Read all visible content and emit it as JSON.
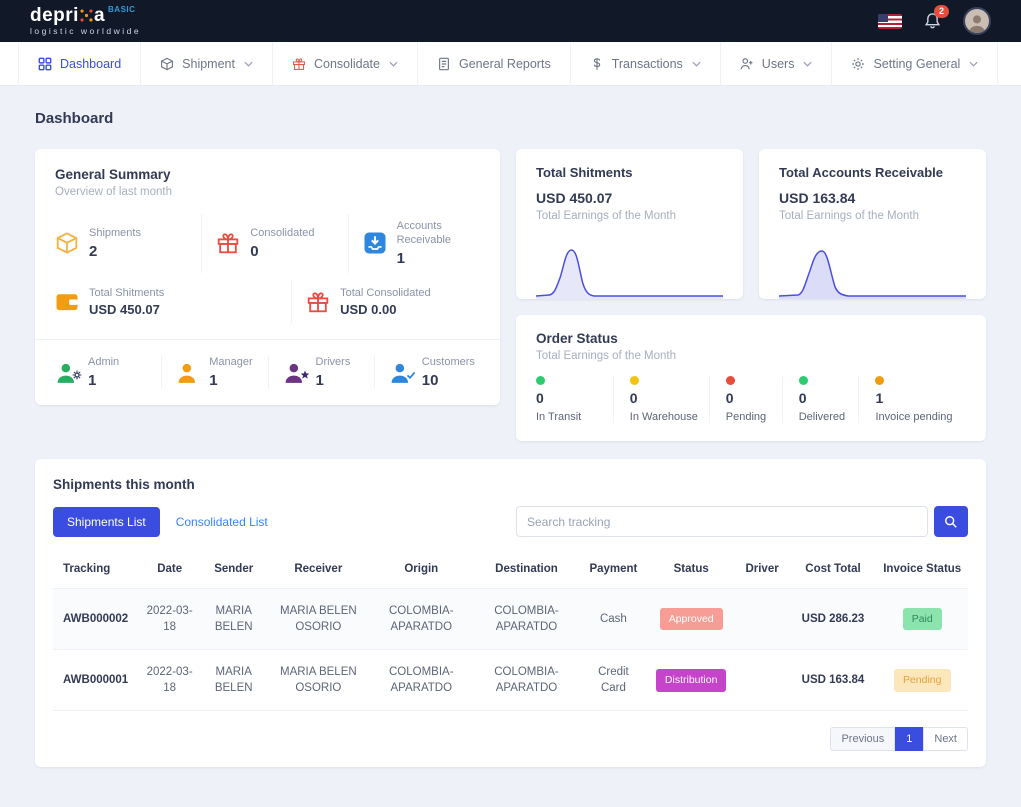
{
  "colors": {
    "primary": "#3b4de0",
    "dark_nav": "#111827",
    "badge_red": "#e74c3c"
  },
  "topbar": {
    "logo_pre": "depri",
    "logo_post": "a",
    "logo_badge": "BASIC",
    "tagline": "logistic  worldwide",
    "notification_count": "2"
  },
  "menu": {
    "items": [
      {
        "label": "Dashboard",
        "icon": "dashboard-icon",
        "active": true,
        "dropdown": false
      },
      {
        "label": "Shipment",
        "icon": "box-icon",
        "active": false,
        "dropdown": true
      },
      {
        "label": "Consolidate",
        "icon": "gift-icon",
        "active": false,
        "dropdown": true
      },
      {
        "label": "General Reports",
        "icon": "report-icon",
        "active": false,
        "dropdown": false
      },
      {
        "label": "Transactions",
        "icon": "dollar-icon",
        "active": false,
        "dropdown": true
      },
      {
        "label": "Users",
        "icon": "user-plus-icon",
        "active": false,
        "dropdown": true
      },
      {
        "label": "Setting General",
        "icon": "gear-icon",
        "active": false,
        "dropdown": true
      }
    ]
  },
  "page_title": "Dashboard",
  "general_summary": {
    "title": "General Summary",
    "subtitle": "Overview of last month",
    "stats": [
      {
        "label": "Shipments",
        "value": "2",
        "icon": "package-icon",
        "color": "#f5b041"
      },
      {
        "label": "Consolidated",
        "value": "0",
        "icon": "gift-icon",
        "color": "#e74c3c"
      },
      {
        "label": "Accounts Receivable",
        "value": "1",
        "icon": "inbox-down-icon",
        "color": "#2e86de"
      },
      {
        "label": "Total Shitments",
        "value": "USD 450.07",
        "icon": "wallet-icon",
        "color": "#f39c12"
      },
      {
        "label": "Total Consolidated",
        "value": "USD 0.00",
        "icon": "gift-icon",
        "color": "#e74c3c"
      }
    ],
    "user_stats": [
      {
        "label": "Admin",
        "value": "1",
        "icon": "admin-user-icon",
        "color": "#27ae60"
      },
      {
        "label": "Manager",
        "value": "1",
        "icon": "manager-user-icon",
        "color": "#f39c12"
      },
      {
        "label": "Drivers",
        "value": "1",
        "icon": "driver-user-icon",
        "color": "#6c3483"
      },
      {
        "label": "Customers",
        "value": "10",
        "icon": "customer-user-icon",
        "color": "#2e86de"
      }
    ]
  },
  "total_shipments_card": {
    "title": "Total Shitments",
    "value": "USD 450.07",
    "subtitle": "Total Earnings of the Month"
  },
  "total_accounts_card": {
    "title": "Total Accounts Receivable",
    "value": "USD 163.84",
    "subtitle": "Total Earnings of the Month"
  },
  "order_status": {
    "title": "Order Status",
    "subtitle": "Total Earnings of the Month",
    "items": [
      {
        "label": "In Transit",
        "value": "0",
        "color": "#2ecc71"
      },
      {
        "label": "In Warehouse",
        "value": "0",
        "color": "#f1c40f"
      },
      {
        "label": "Pending",
        "value": "0",
        "color": "#e74c3c"
      },
      {
        "label": "Delivered",
        "value": "0",
        "color": "#2ecc71"
      },
      {
        "label": "Invoice pending",
        "value": "1",
        "color": "#f39c12"
      }
    ]
  },
  "shipments": {
    "title": "Shipments this month",
    "tab_shipments": "Shipments List",
    "tab_consolidated": "Consolidated List",
    "search_placeholder": "Search tracking",
    "headers": [
      "Tracking",
      "Date",
      "Sender",
      "Receiver",
      "Origin",
      "Destination",
      "Payment",
      "Status",
      "Driver",
      "Cost Total",
      "Invoice Status"
    ],
    "rows": [
      {
        "tracking": "AWB000002",
        "date": "2022-03-18",
        "sender": "MARIA BELEN",
        "receiver": "MARIA BELEN OSORIO",
        "origin": "COLOMBIA-APARATDO",
        "destination": "COLOMBIA-APARATDO",
        "payment": "Cash",
        "status": {
          "label": "Approved",
          "bg": "#f79d95",
          "fg": "#ffffff"
        },
        "driver": "",
        "cost": "USD 286.23",
        "invoice": {
          "label": "Paid",
          "bg": "#8ce3ae",
          "fg": "#2e8b57"
        }
      },
      {
        "tracking": "AWB000001",
        "date": "2022-03-18",
        "sender": "MARIA BELEN",
        "receiver": "MARIA BELEN OSORIO",
        "origin": "COLOMBIA-APARATDO",
        "destination": "COLOMBIA-APARATDO",
        "payment": "Credit Card",
        "status": {
          "label": "Distribution",
          "bg": "#c643cb",
          "fg": "#ffffff"
        },
        "driver": "",
        "cost": "USD 163.84",
        "invoice": {
          "label": "Pending",
          "bg": "#fce7bd",
          "fg": "#e6a23c"
        }
      }
    ],
    "pagination": {
      "previous": "Previous",
      "page": "1",
      "next": "Next"
    }
  }
}
